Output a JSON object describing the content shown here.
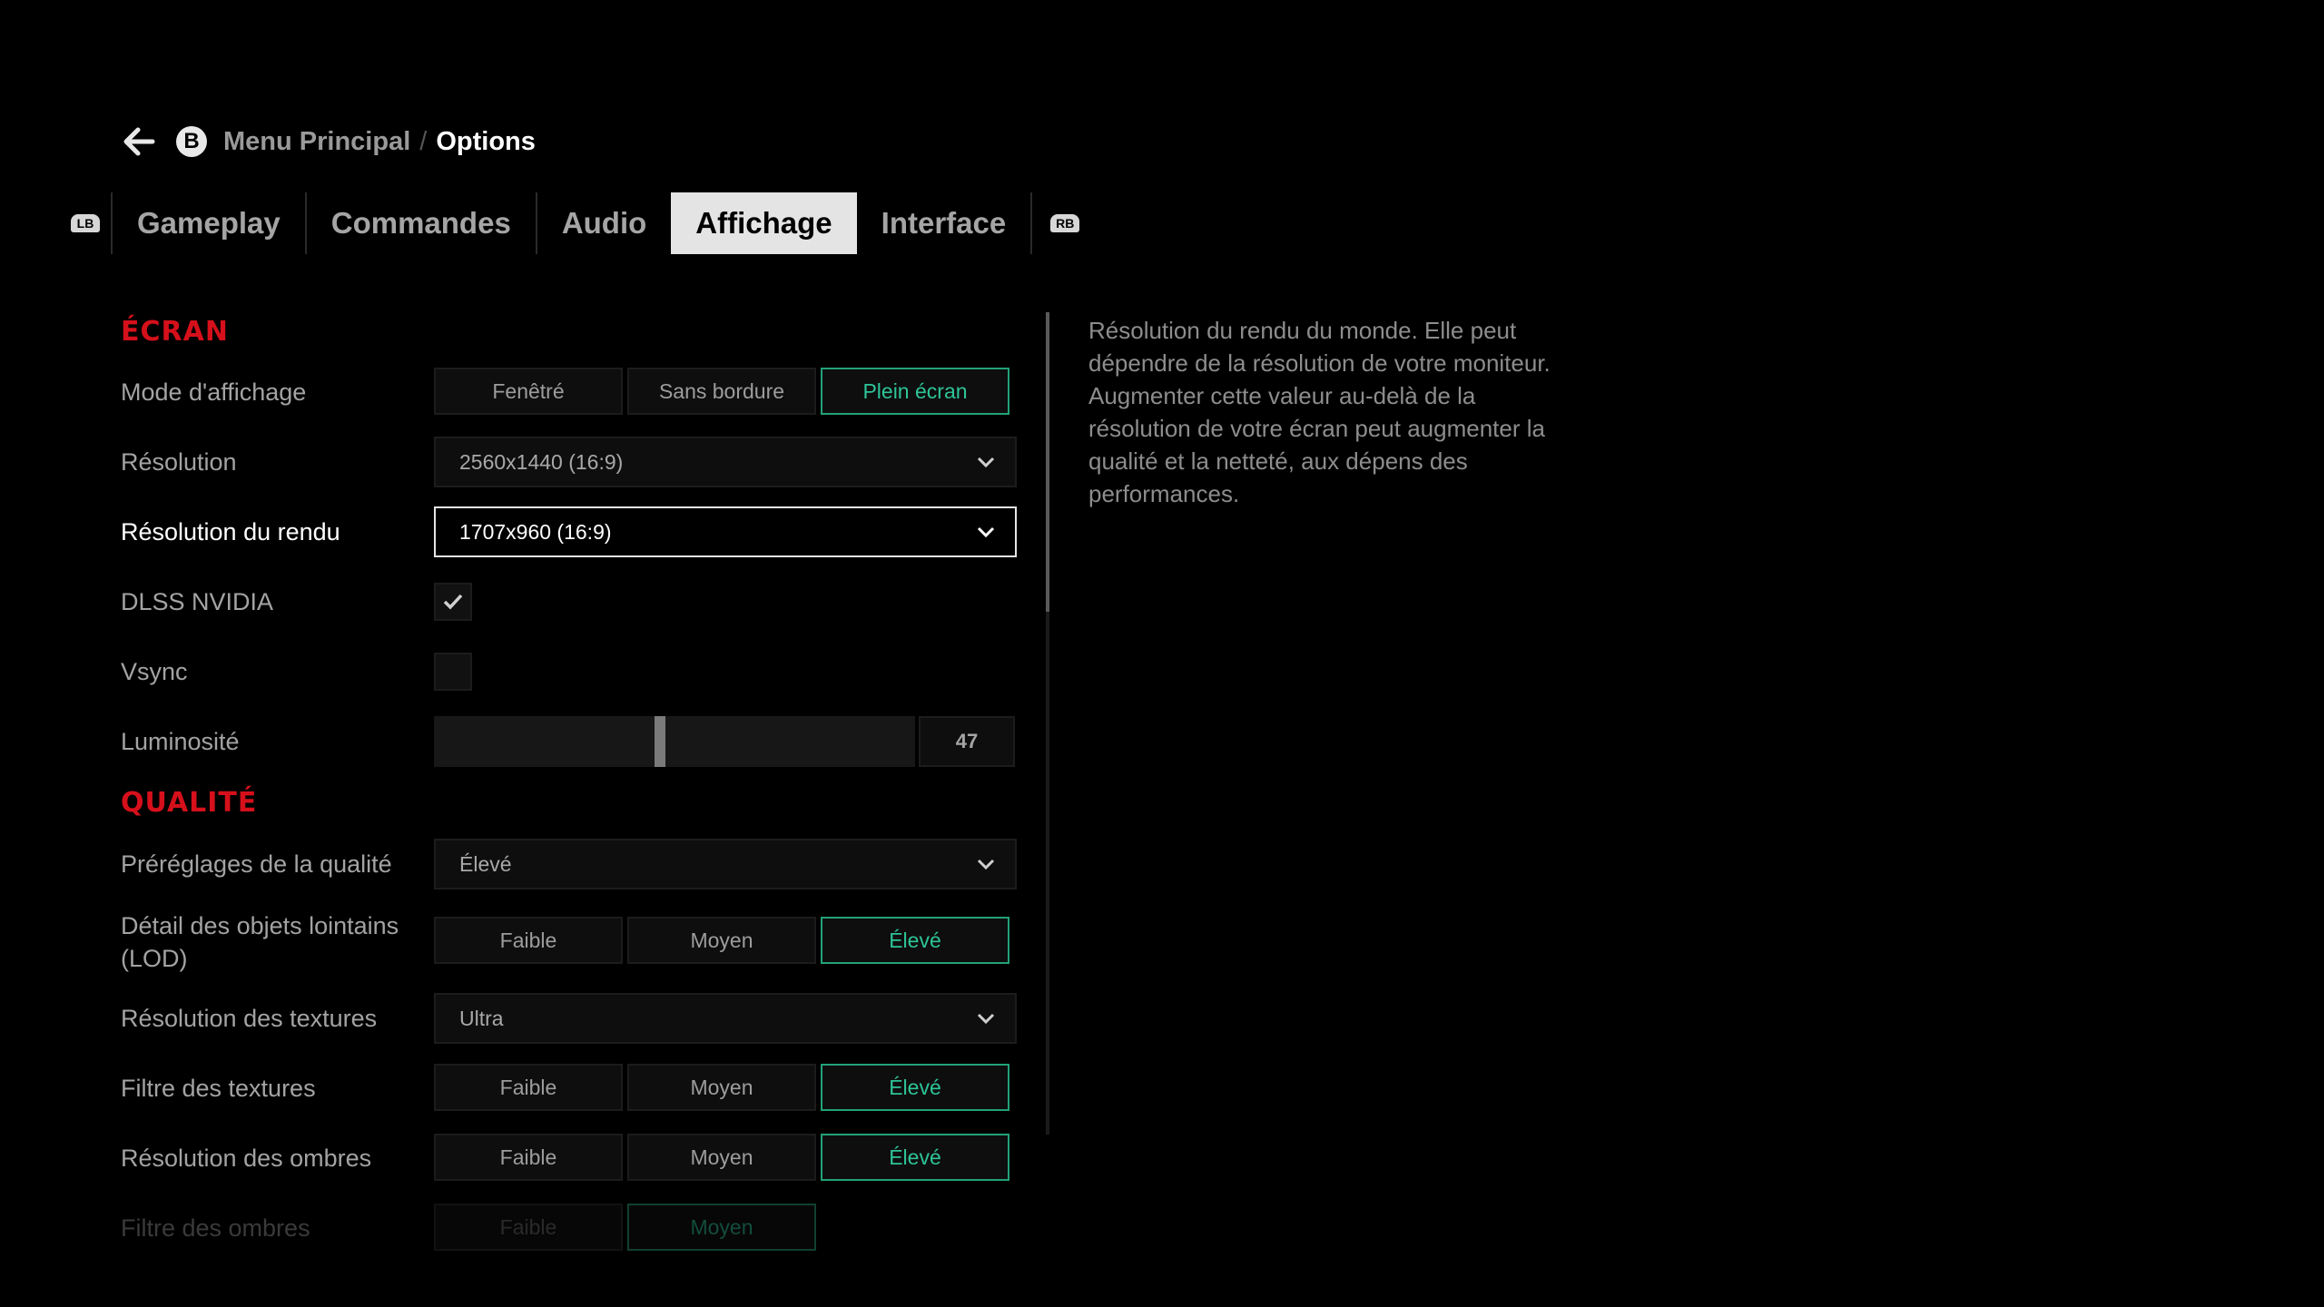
{
  "breadcrumb": {
    "back_key": "B",
    "previous": "Menu Principal",
    "separator": "/",
    "current": "Options"
  },
  "tabs": {
    "left_bumper": "LB",
    "right_bumper": "RB",
    "items": [
      {
        "label": "Gameplay",
        "active": false
      },
      {
        "label": "Commandes",
        "active": false
      },
      {
        "label": "Audio",
        "active": false
      },
      {
        "label": "Affichage",
        "active": true
      },
      {
        "label": "Interface",
        "active": false
      }
    ]
  },
  "sections": {
    "screen": "ÉCRAN",
    "quality": "QUALITÉ"
  },
  "settings": {
    "display_mode": {
      "label": "Mode d'affichage",
      "options": [
        "Fenêtré",
        "Sans bordure",
        "Plein écran"
      ],
      "selected": "Plein écran"
    },
    "resolution": {
      "label": "Résolution",
      "value": "2560x1440 (16:9)"
    },
    "render_resolution": {
      "label": "Résolution du rendu",
      "value": "1707x960 (16:9)"
    },
    "dlss": {
      "label": "DLSS NVIDIA",
      "checked": true
    },
    "vsync": {
      "label": "Vsync",
      "checked": false
    },
    "brightness": {
      "label": "Luminosité",
      "value": "47",
      "level_percent": 47
    },
    "quality_preset": {
      "label": "Préréglages de la qualité",
      "value": "Élevé"
    },
    "lod": {
      "label_line1": "Détail des objets lointains",
      "label_line2": "(LOD)",
      "options": [
        "Faible",
        "Moyen",
        "Élevé"
      ],
      "selected": "Élevé"
    },
    "texture_resolution": {
      "label": "Résolution des textures",
      "value": "Ultra"
    },
    "texture_filter": {
      "label": "Filtre des textures",
      "options": [
        "Faible",
        "Moyen",
        "Élevé"
      ],
      "selected": "Élevé"
    },
    "shadow_resolution": {
      "label": "Résolution des ombres",
      "options": [
        "Faible",
        "Moyen",
        "Élevé"
      ],
      "selected": "Élevé"
    },
    "shadow_filter": {
      "label": "Filtre des ombres",
      "options": [
        "Faible",
        "Moyen"
      ],
      "selected": "Moyen"
    }
  },
  "description": "Résolution du rendu du monde. Elle peut dépendre de la résolution de votre moniteur. Augmenter cette valeur au-delà de la résolution de votre écran peut augmenter la qualité et la netteté, aux dépens des performances.",
  "colors": {
    "accent_red": "#d5101b",
    "selected_green": "#2ec498",
    "background": "#000000"
  }
}
